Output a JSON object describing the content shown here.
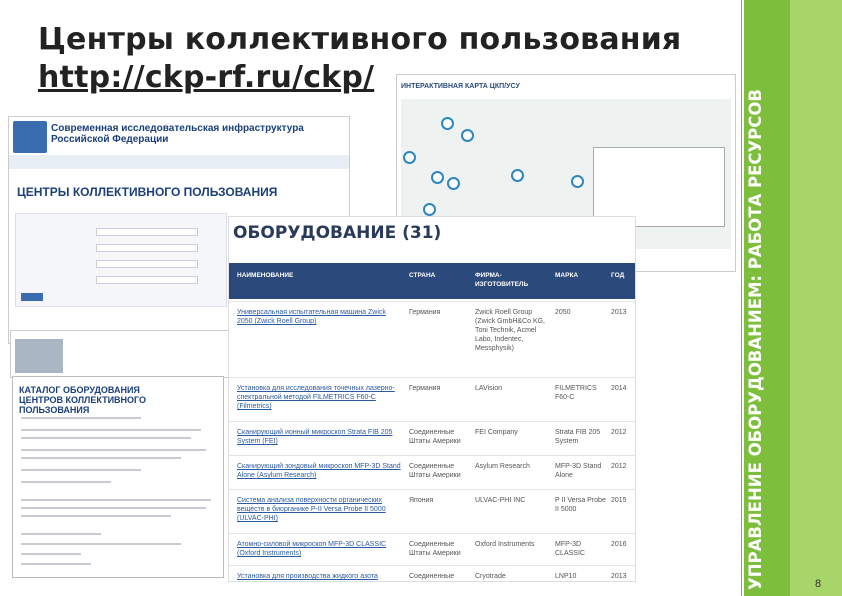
{
  "slide": {
    "title": "Центры коллективного пользования",
    "url": "http://ckp-rf.ru/ckp/",
    "side_label": "УПРАВЛЕНИЕ ОБОРУДОВАНИЕМ: РАБОТА РЕСУРСОВ",
    "page_number": "8"
  },
  "site": {
    "header": "Современная исследовательская инфраструктура Российской Федерации",
    "page_title": "ЦЕНТРЫ КОЛЛЕКТИВНОГО ПОЛЬЗОВАНИЯ"
  },
  "catalog": {
    "title": "КАТАЛОГ ОБОРУДОВАНИЯ ЦЕНТРОВ КОЛЛЕКТИВНОГО ПОЛЬЗОВАНИЯ"
  },
  "map": {
    "title": "ИНТЕРАКТИВНАЯ КАРТА ЦКП/УСУ"
  },
  "equipment": {
    "title": "ОБОРУДОВАНИЕ (31)",
    "columns": [
      "НАИМЕНОВАНИЕ",
      "СТРАНА",
      "ФИРМА-ИЗГОТОВИТЕЛЬ",
      "МАРКА",
      "ГОД"
    ],
    "rows": [
      {
        "name": "Универсальная испытательная машина Zwick 2050 (Zwick Roell Group)",
        "country": "Германия",
        "maker": "Zwick Roell Group (Zwick GmbH&Co KG, Toni Technik, Acmel Labo, Indentec, Messphysik)",
        "model": "2050",
        "year": "2013"
      },
      {
        "name": "Установка для исследования точечных лазерно-спектральной методой FILMETRICS F60-C (Filmetrics)",
        "country": "Германия",
        "maker": "LAVision",
        "model": "FILMETRICS F60-C",
        "year": "2014"
      },
      {
        "name": "Сканирующий ионный микроскоп Strata FIB 205 System (FEI)",
        "country": "Соединенные Штаты Америки",
        "maker": "FEI Company",
        "model": "Strata FIB 205 System",
        "year": "2012"
      },
      {
        "name": "Сканирующий зондовый микроскоп MFP-3D Stand Alone (Asylum Research)",
        "country": "Соединенные Штаты Америки",
        "maker": "Asylum Research",
        "model": "MFP-3D Stand Alone",
        "year": "2012"
      },
      {
        "name": "Система анализа поверхности органических веществ в биорганике P-II Versa Probe II 5000 (ULVAC-PHI)",
        "country": "Япония",
        "maker": "ULVAC-PHI INC",
        "model": "P II Versa Probe II 5000",
        "year": "2015"
      },
      {
        "name": "Атомно-силовой микроскоп MFP-3D CLASSIC (Oxford Instruments)",
        "country": "Соединенные Штаты Америки",
        "maker": "Oxford Instruments",
        "model": "MFP-3D CLASSIC",
        "year": "2016"
      },
      {
        "name": "Установка для производства жидкого азота",
        "country": "Соединенные Штаты Америки",
        "maker": "Cryotrade",
        "model": "LNP10",
        "year": "2013"
      }
    ]
  }
}
